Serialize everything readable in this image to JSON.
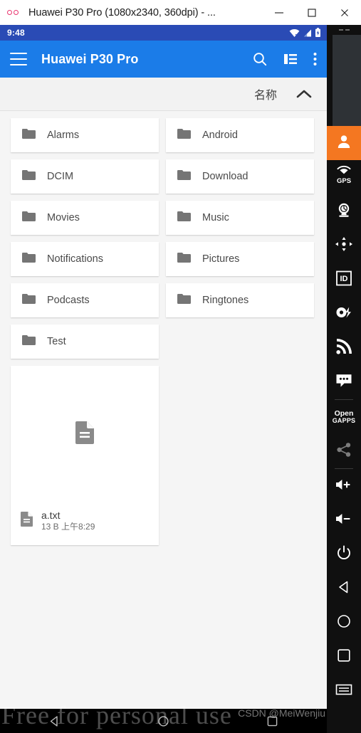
{
  "window": {
    "title": "Huawei P30 Pro (1080x2340, 360dpi) - ...",
    "minimize_label": "Minimize",
    "maximize_label": "Maximize",
    "close_label": "Close"
  },
  "device": {
    "status_bar": {
      "clock": "9:48",
      "icons": [
        "wifi-off-icon",
        "cellular-signal-icon",
        "battery-charging-icon"
      ]
    },
    "app_bar": {
      "title": "Huawei P30 Pro",
      "menu_icon": "hamburger-menu-icon",
      "search_icon": "search-icon",
      "view_icon": "list-view-icon",
      "overflow_icon": "overflow-menu-icon"
    },
    "sort_bar": {
      "label": "名称",
      "direction_icon": "chevron-up-icon"
    },
    "folders": [
      {
        "name": "Alarms"
      },
      {
        "name": "Android"
      },
      {
        "name": "DCIM"
      },
      {
        "name": "Download"
      },
      {
        "name": "Movies"
      },
      {
        "name": "Music"
      },
      {
        "name": "Notifications"
      },
      {
        "name": "Pictures"
      },
      {
        "name": "Podcasts"
      },
      {
        "name": "Ringtones"
      },
      {
        "name": "Test"
      }
    ],
    "file": {
      "name": "a.txt",
      "details": "13 B 上午8:29"
    },
    "nav_bar": {
      "back_label": "Back",
      "home_label": "Home",
      "recents_label": "Recents"
    },
    "watermark": "Free for personal use",
    "csdn_watermark": "CSDN @MeiWenjiu"
  },
  "gm_toolbar": {
    "items": [
      {
        "name": "identity-avatar-button",
        "icon": "person-icon",
        "active": true
      },
      {
        "name": "gps-button",
        "icon": "gps-icon",
        "label": "GPS"
      },
      {
        "name": "camera-button",
        "icon": "camera-icon"
      },
      {
        "name": "accelerometer-button",
        "icon": "dpad-icon"
      },
      {
        "name": "identifiers-button",
        "icon": "id-badge-icon"
      },
      {
        "name": "battery-button",
        "icon": "battery-bolt-icon"
      },
      {
        "name": "network-button",
        "icon": "network-signal-icon"
      },
      {
        "name": "sms-button",
        "icon": "message-bubble-icon"
      },
      {
        "name": "open-gapps-button",
        "icon": "open-gapps-icon",
        "line1": "Open",
        "line2": "GAPPS"
      },
      {
        "name": "share-button",
        "icon": "share-icon"
      },
      {
        "name": "volume-up-button",
        "icon": "volume-up-icon"
      },
      {
        "name": "volume-down-button",
        "icon": "volume-down-icon"
      },
      {
        "name": "power-button",
        "icon": "power-icon"
      },
      {
        "name": "back-button",
        "icon": "triangle-back-icon"
      },
      {
        "name": "home-button",
        "icon": "circle-home-icon"
      },
      {
        "name": "recents-button",
        "icon": "square-recents-icon"
      },
      {
        "name": "keyboard-button",
        "icon": "keyboard-icon"
      }
    ]
  }
}
